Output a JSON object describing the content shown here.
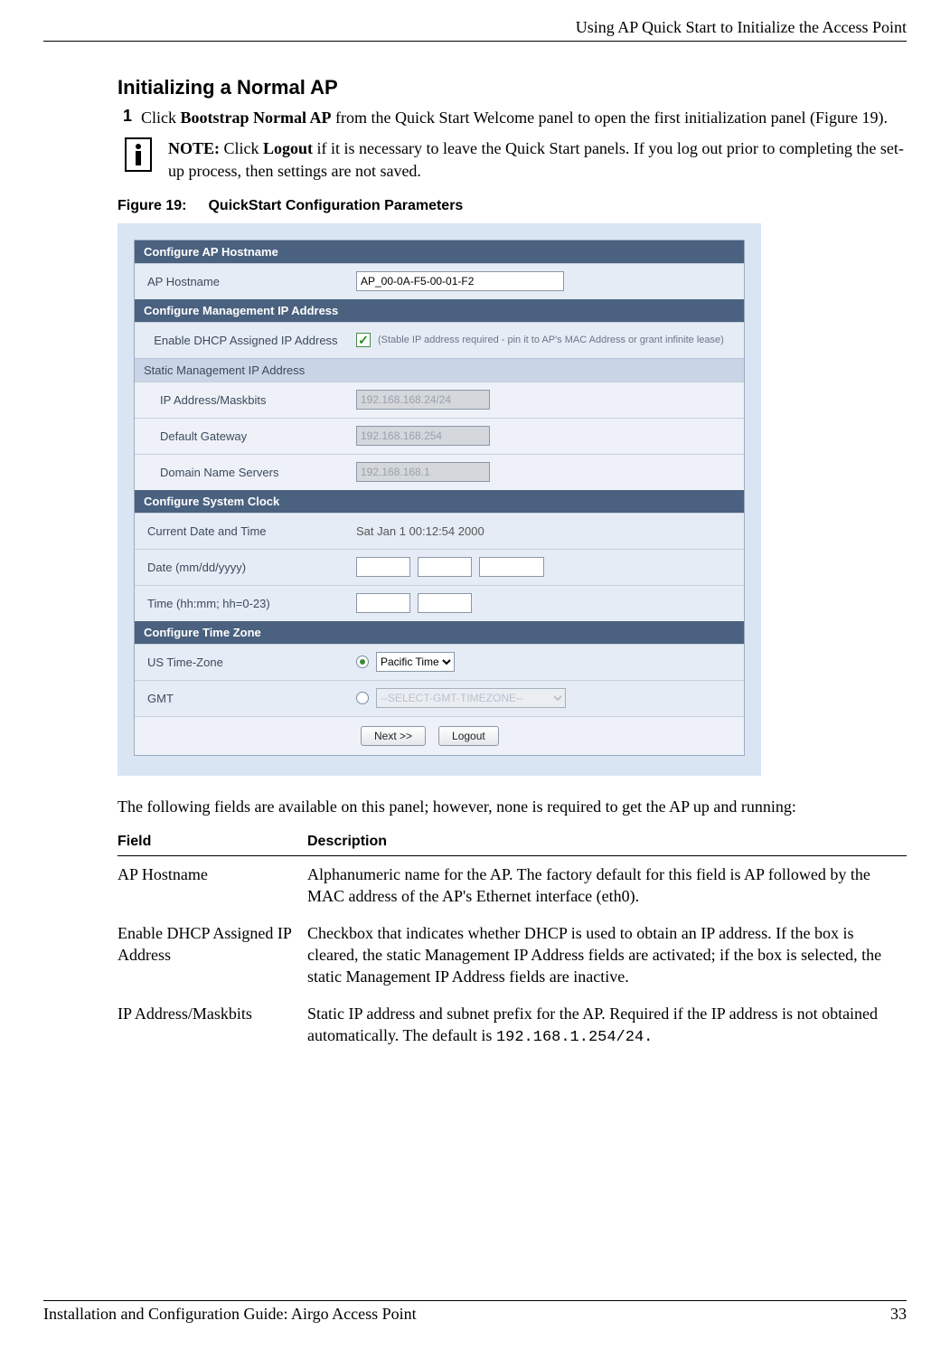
{
  "header": {
    "right": "Using AP Quick Start to Initialize the Access Point"
  },
  "section": {
    "title": "Initializing a Normal AP"
  },
  "step1": {
    "num": "1",
    "pre": "Click ",
    "bold": "Bootstrap Normal AP",
    "post": " from the Quick Start Welcome panel to open the first initialization panel (Figure 19)."
  },
  "note": {
    "label": "NOTE:",
    "pre": " Click ",
    "bold": "Logout",
    "post": " if it is necessary to leave the Quick Start panels. If you log out prior to completing the set-up process, then settings are not saved."
  },
  "figure": {
    "label": "Figure 19:",
    "title": "QuickStart Configuration Parameters"
  },
  "panel": {
    "s1": {
      "hdr": "Configure AP Hostname",
      "hostname_lbl": "AP Hostname",
      "hostname_val": "AP_00-0A-F5-00-01-F2"
    },
    "s2": {
      "hdr": "Configure Management IP Address",
      "dhcp_lbl": "  Enable DHCP Assigned IP Address",
      "dhcp_hint": "(Stable IP address required - pin it to AP's MAC Address or grant infinite lease)",
      "subhdr": "Static Management IP Address",
      "ipmask_lbl": "IP Address/Maskbits",
      "ipmask_val": "192.168.168.24/24",
      "gw_lbl": "Default Gateway",
      "gw_val": "192.168.168.254",
      "dns_lbl": "Domain Name Servers",
      "dns_val": "192.168.168.1"
    },
    "s3": {
      "hdr": "Configure System Clock",
      "curdt_lbl": "Current Date and Time",
      "curdt_val": "Sat Jan 1 00:12:54 2000",
      "date_lbl": "Date (mm/dd/yyyy)",
      "time_lbl": "Time (hh:mm; hh=0-23)"
    },
    "s4": {
      "hdr": "Configure Time Zone",
      "ustz_lbl": "US Time-Zone",
      "ustz_val": "Pacific Time",
      "gmt_lbl": "GMT",
      "gmt_val": "--SELECT-GMT-TIMEZONE--"
    },
    "buttons": {
      "next": "Next >>",
      "logout": "Logout"
    }
  },
  "after_para": "The following fields are available on this panel; however, none is required to get the AP up and running:",
  "table": {
    "h1": "Field",
    "h2": "Description",
    "rows": [
      {
        "f": "AP Hostname",
        "d": "Alphanumeric name for the AP. The factory default for this field is AP followed by the MAC address of the AP's Ethernet interface (eth0)."
      },
      {
        "f": "Enable DHCP Assigned IP Address",
        "d": "Checkbox that indicates whether DHCP is used to obtain an IP address. If the box is cleared, the static Management IP Address fields are activated; if the box is selected, the static Management IP Address fields are inactive."
      },
      {
        "f": "IP Address/Maskbits",
        "d_pre": "Static IP address and subnet prefix for the AP. Required if the IP address is not obtained automatically. The default is ",
        "d_code": "192.168.1.254/24."
      }
    ]
  },
  "footer": {
    "left": "Installation and Configuration Guide: Airgo Access Point",
    "right": "33"
  }
}
